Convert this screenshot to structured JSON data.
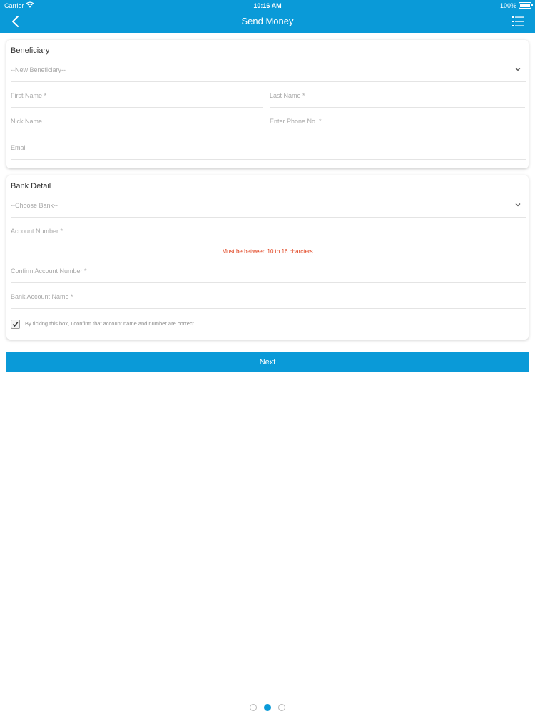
{
  "status_bar": {
    "carrier": "Carrier",
    "time": "10:16 AM",
    "battery": "100%"
  },
  "nav": {
    "title": "Send Money",
    "back_icon": "chevron-left-icon",
    "menu_icon": "list-menu-icon"
  },
  "beneficiary": {
    "title": "Beneficiary",
    "select": "--New Beneficiary--",
    "first_name": "First Name *",
    "last_name": "Last Name *",
    "nick_name": "Nick Name",
    "phone": "Enter Phone No. *",
    "email": "Email"
  },
  "bank_detail": {
    "title": "Bank Detail",
    "select": "--Choose Bank--",
    "account_number": "Account Number *",
    "error": "Must be between 10 to 16 charcters",
    "confirm_account_number": "Confirm Account Number *",
    "bank_account_name": "Bank Account Name *",
    "confirm_checkbox_label": "By ticking this box, I confirm that account name and number are correct.",
    "confirm_checked": true
  },
  "actions": {
    "next": "Next"
  },
  "pager": {
    "pages": 3,
    "current": 2
  },
  "colors": {
    "accent": "#0a9ad8",
    "error": "#e0401c"
  }
}
